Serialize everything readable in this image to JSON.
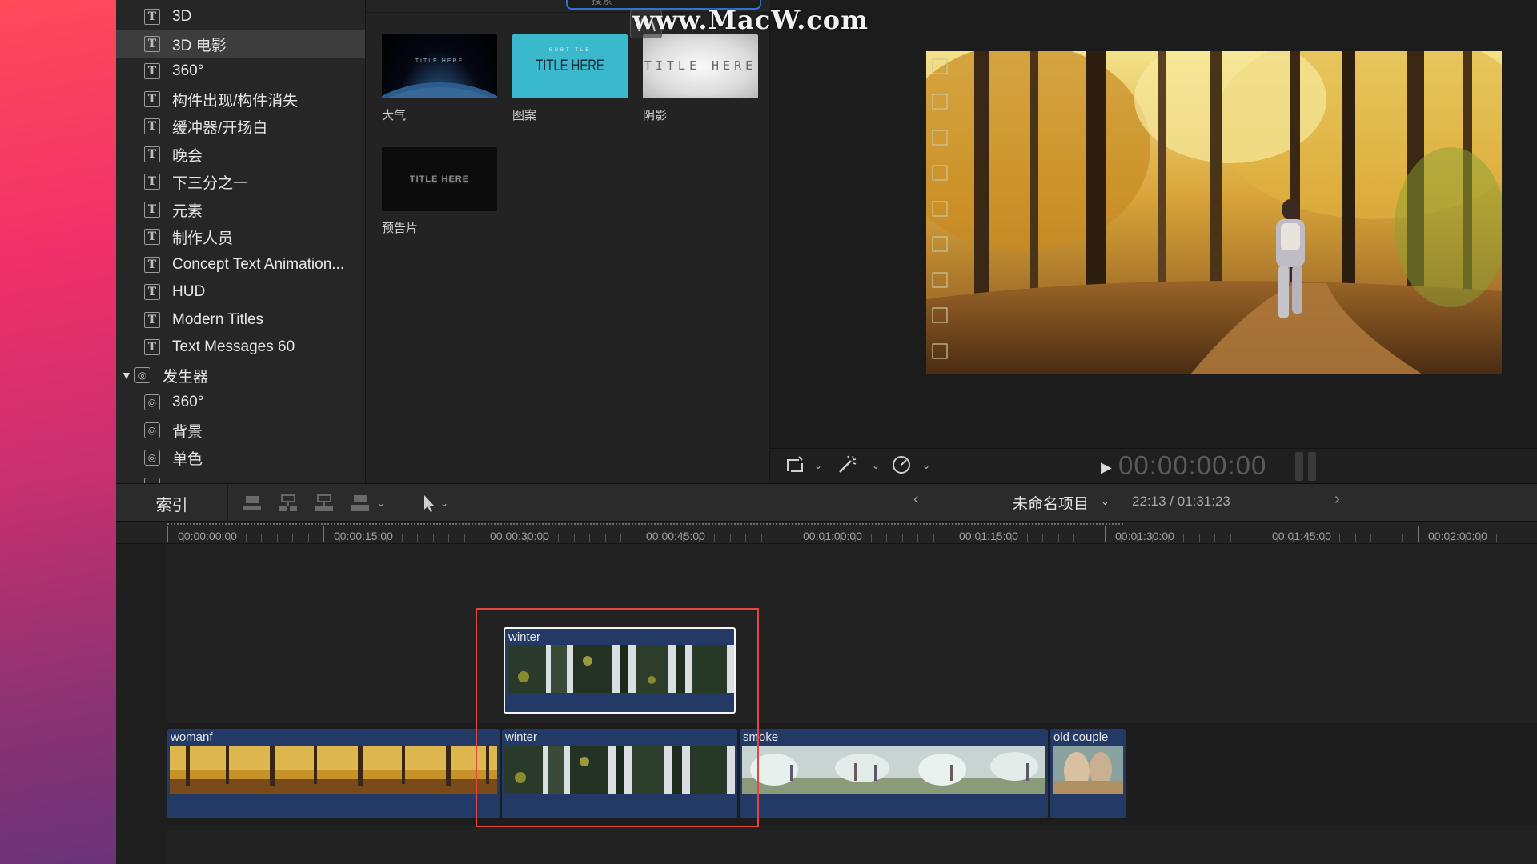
{
  "sidebar": {
    "items": [
      {
        "label": "3D",
        "icon": "title-icon"
      },
      {
        "label": "3D 电影",
        "icon": "title-icon",
        "selected": true
      },
      {
        "label": "360°",
        "icon": "title-icon"
      },
      {
        "label": "构件出现/构件消失",
        "icon": "title-icon"
      },
      {
        "label": "缓冲器/开场白",
        "icon": "title-icon"
      },
      {
        "label": "晚会",
        "icon": "title-icon"
      },
      {
        "label": "下三分之一",
        "icon": "title-icon"
      },
      {
        "label": "元素",
        "icon": "title-icon"
      },
      {
        "label": "制作人员",
        "icon": "title-icon"
      },
      {
        "label": "Concept Text Animation...",
        "icon": "title-icon"
      },
      {
        "label": "HUD",
        "icon": "title-icon"
      },
      {
        "label": "Modern Titles",
        "icon": "title-icon"
      },
      {
        "label": "Text Messages 60",
        "icon": "title-icon"
      }
    ],
    "generator_group": {
      "label": "发生器",
      "icon": "generator-icon"
    },
    "generator_items": [
      {
        "label": "360°"
      },
      {
        "label": "背景"
      },
      {
        "label": "单色"
      }
    ],
    "title_icon_glyph": "T",
    "generator_icon_glyph": "◎"
  },
  "browser": {
    "search_placeholder": "搜索",
    "thumbnails": [
      {
        "label": "大气",
        "caption": "TITLE HERE"
      },
      {
        "label": "图案",
        "caption": "TITLE HERE",
        "subcaption": "SUBTITLE"
      },
      {
        "label": "阴影",
        "caption": "TITLE HERE"
      },
      {
        "label": "预告片",
        "caption": "TITLE HERE"
      }
    ]
  },
  "watermark": "www.MacW.com",
  "viewer": {
    "timecode": "00:00:00:00"
  },
  "timeline_toolbar": {
    "index_label": "索引",
    "project_name": "未命名项目",
    "duration": "22:13 / 01:31:23"
  },
  "ruler": {
    "labels": [
      "00:00:00:00",
      "00:00:15:00",
      "00:00:30:00",
      "00:00:45:00",
      "00:01:00:00",
      "00:01:15:00",
      "00:01:30:00",
      "00:01:45:00",
      "00:02:00:00"
    ]
  },
  "clips": {
    "connected": {
      "title": "winter"
    },
    "primary": [
      {
        "title": "womanf"
      },
      {
        "title": "winter"
      },
      {
        "title": "smoke"
      },
      {
        "title": "old couple"
      }
    ]
  },
  "colors": {
    "accent_blue": "#3a6fd0",
    "clip_blue": "#243a66",
    "highlight_red": "#e5453d",
    "title_cyan": "#3ab8cc"
  }
}
